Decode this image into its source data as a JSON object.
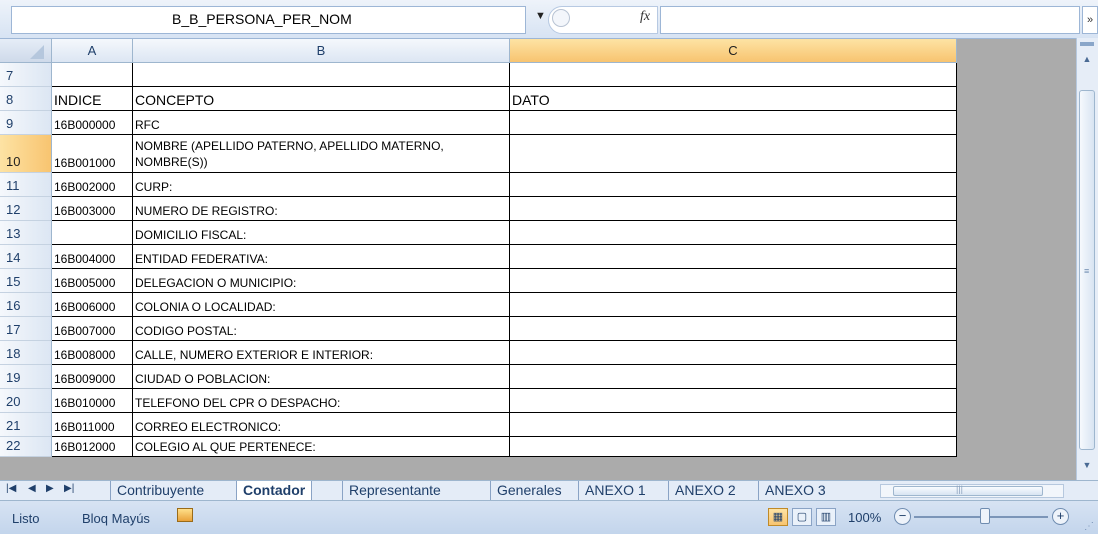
{
  "formula_bar": {
    "name_box": "B_B_PERSONA_PER_NOM",
    "fx_label": "fx",
    "formula_value": ""
  },
  "grid": {
    "columns": [
      {
        "label": "A",
        "selected": false
      },
      {
        "label": "B",
        "selected": false
      },
      {
        "label": "C",
        "selected": true
      }
    ],
    "rows": [
      {
        "num": "7",
        "a": "",
        "b": "",
        "c": "",
        "selected": false
      },
      {
        "num": "8",
        "a": "INDICE",
        "b": "CONCEPTO",
        "c": "DATO",
        "selected": false
      },
      {
        "num": "9",
        "a": "16B000000",
        "b": "RFC",
        "c": "",
        "selected": false
      },
      {
        "num": "10",
        "a": "16B001000",
        "b": "NOMBRE (APELLIDO PATERNO, APELLIDO MATERNO, NOMBRE(S))",
        "c": "",
        "selected": true
      },
      {
        "num": "11",
        "a": "16B002000",
        "b": "CURP:",
        "c": "",
        "selected": false
      },
      {
        "num": "12",
        "a": "16B003000",
        "b": "NUMERO DE REGISTRO:",
        "c": "",
        "selected": false
      },
      {
        "num": "13",
        "a": "",
        "b": "DOMICILIO FISCAL:",
        "c": "",
        "selected": false
      },
      {
        "num": "14",
        "a": "16B004000",
        "b": "ENTIDAD FEDERATIVA:",
        "c": "",
        "selected": false
      },
      {
        "num": "15",
        "a": "16B005000",
        "b": "DELEGACION O MUNICIPIO:",
        "c": "",
        "selected": false
      },
      {
        "num": "16",
        "a": "16B006000",
        "b": "COLONIA O LOCALIDAD:",
        "c": "",
        "selected": false
      },
      {
        "num": "17",
        "a": "16B007000",
        "b": "CODIGO POSTAL:",
        "c": "",
        "selected": false
      },
      {
        "num": "18",
        "a": "16B008000",
        "b": "CALLE, NUMERO EXTERIOR E INTERIOR:",
        "c": "",
        "selected": false
      },
      {
        "num": "19",
        "a": "16B009000",
        "b": "CIUDAD O POBLACION:",
        "c": "",
        "selected": false
      },
      {
        "num": "20",
        "a": "16B010000",
        "b": "TELEFONO DEL CPR O DESPACHO:",
        "c": "",
        "selected": false
      },
      {
        "num": "21",
        "a": "16B011000",
        "b": "CORREO ELECTRONICO:",
        "c": "",
        "selected": false
      },
      {
        "num": "22",
        "a": "16B012000",
        "b": "COLEGIO AL QUE PERTENECE:",
        "c": "",
        "selected": false
      }
    ]
  },
  "sheet_tabs": {
    "tabs": [
      "Contribuyente",
      "Contador",
      "Representante",
      "Generales",
      "ANEXO 1",
      "ANEXO 2",
      "ANEXO 3"
    ],
    "active": "Contador"
  },
  "status_bar": {
    "ready": "Listo",
    "caps_lock": "Bloq Mayús",
    "zoom": "100%"
  },
  "icons": [
    "fx-icon",
    "dropdown-arrow-icon",
    "macro-record-icon",
    "normal-view-icon",
    "page-layout-icon",
    "page-break-icon",
    "zoom-out-icon",
    "zoom-in-icon"
  ],
  "colors": {
    "selected_header": "#f8c470",
    "header_bg": "#dce6f3",
    "frame_bg": "#dbe5f1"
  }
}
